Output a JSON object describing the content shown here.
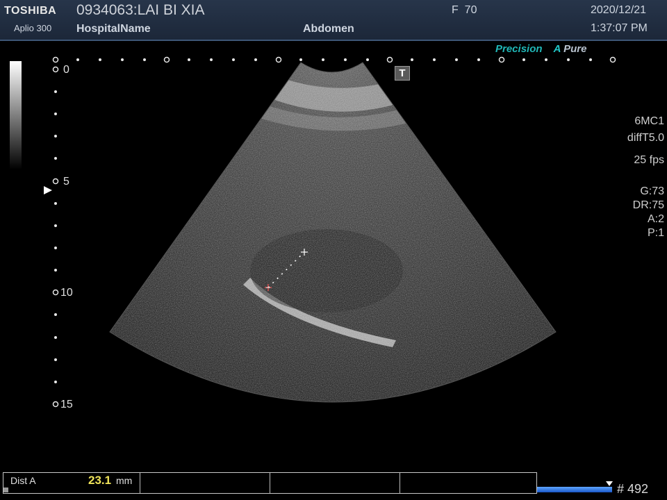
{
  "header": {
    "brand": "TOSHIBA",
    "model": "Aplio 300",
    "patient": "0934063:LAI BI XIA",
    "hospital": "HospitalName",
    "frequency": "F  70",
    "exam": "Abdomen",
    "date": "2020/12/21",
    "time": "1:37:07 PM"
  },
  "image_tags": {
    "precision": "Precision",
    "apure_a": "A",
    "apure_text": "Pure"
  },
  "trace_badge": "T",
  "params": {
    "probe": "6MC1",
    "mode": "diffT5.0",
    "fps": "25 fps",
    "gain": "G:73",
    "dynamic_range": "DR:75",
    "a": "A:2",
    "p": "P:1"
  },
  "depth_scale": {
    "labels": [
      "0",
      "5",
      "10",
      "15"
    ]
  },
  "measurement": {
    "label": "Dist A",
    "value": "23.1",
    "unit": "mm"
  },
  "cine": {
    "frame": "# 492"
  }
}
